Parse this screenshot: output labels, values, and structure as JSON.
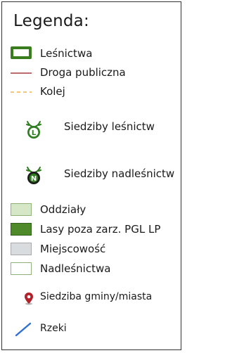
{
  "legend": {
    "title": "Legenda:",
    "items": [
      {
        "label": "Leśnictwa",
        "symbol": "outline-rect",
        "stroke": "#3a7d1e",
        "fill": "#ffffff"
      },
      {
        "label": "Droga publiczna",
        "symbol": "line",
        "stroke": "#a83a3e"
      },
      {
        "label": "Kolej",
        "symbol": "dashed-line",
        "stroke": "#f0c878"
      },
      {
        "label": "Siedziby leśnictw",
        "symbol": "forestry-seat-icon",
        "letter": "L",
        "color": "#2e7d1f"
      },
      {
        "label": "Siedziby nadleśnictw",
        "symbol": "district-seat-icon",
        "letter": "N",
        "color": "#1b1b1b"
      },
      {
        "label": "Oddziały",
        "symbol": "fill-rect",
        "fill": "#d6e7c8",
        "stroke": "#8fb27a"
      },
      {
        "label": "Lasy poza zarz. PGL LP",
        "symbol": "fill-rect",
        "fill": "#4f8a2a",
        "stroke": "#2f5f18"
      },
      {
        "label": "Miejscowość",
        "symbol": "fill-rect",
        "fill": "#d9dcdf",
        "stroke": "#a7aaad"
      },
      {
        "label": "Nadleśnictwa",
        "symbol": "fill-rect",
        "fill": "#ffffff",
        "stroke": "#8fb27a"
      },
      {
        "label": "Siedziba gminy/miasta",
        "symbol": "pin-icon",
        "color": "#b3202a"
      },
      {
        "label": "Rzeki",
        "symbol": "river-line",
        "stroke": "#2f6fd6"
      }
    ]
  }
}
